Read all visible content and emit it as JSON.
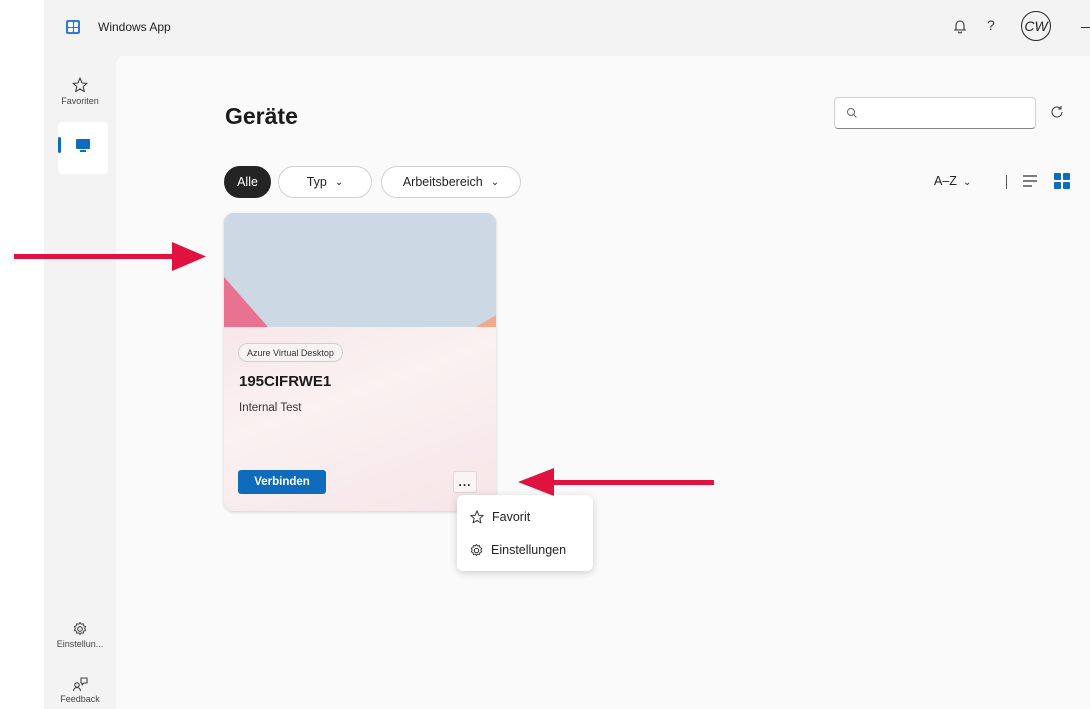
{
  "app": {
    "title": "Windows App",
    "avatar_initials": "CW",
    "help_glyph": "?"
  },
  "nav": {
    "items": [
      {
        "label": "Favoriten",
        "icon": "star-icon"
      },
      {
        "label": "",
        "icon": "monitor-icon",
        "selected": true
      },
      {
        "label": "Einstellun...",
        "icon": "gear-icon"
      },
      {
        "label": "Feedback",
        "icon": "feedback-icon"
      }
    ]
  },
  "main": {
    "title": "Geräte",
    "search": {
      "placeholder": "",
      "value": ""
    },
    "filters": [
      {
        "label": "Alle",
        "active": true
      },
      {
        "label": "Typ",
        "active": false
      },
      {
        "label": "Arbeitsbereich",
        "active": false
      }
    ],
    "sort_label": "A–Z"
  },
  "card": {
    "badge": "Azure Virtual Desktop",
    "name": "195CIFRWE1",
    "workspace": "Internal Test",
    "connect_label": "Verbinden",
    "more_label": "..."
  },
  "menu": {
    "items": [
      {
        "label": "Favorit",
        "icon": "star-icon"
      },
      {
        "label": "Einstellungen",
        "icon": "gear-icon"
      }
    ]
  },
  "colors": {
    "accent": "#0f6cbd",
    "annotation_arrow": "#e0123f"
  }
}
